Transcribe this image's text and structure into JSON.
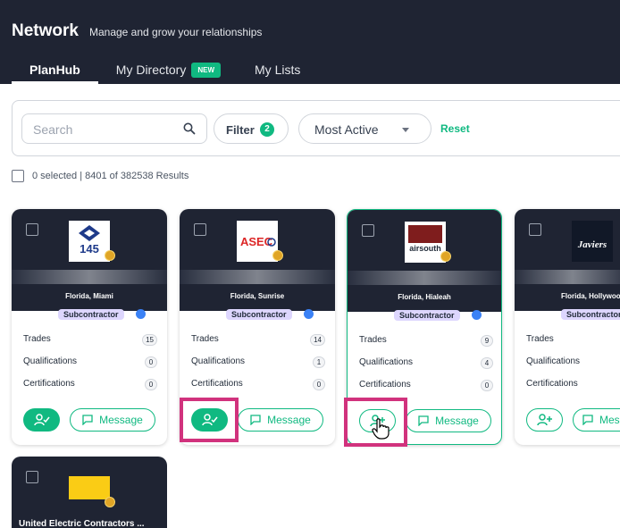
{
  "header": {
    "title": "Network",
    "subtitle": "Manage and grow your relationships",
    "tabs": [
      {
        "label": "PlanHub",
        "active": true
      },
      {
        "label": "My Directory",
        "badge": "NEW"
      },
      {
        "label": "My Lists"
      }
    ]
  },
  "toolbar": {
    "search_placeholder": "Search",
    "filter_label": "Filter",
    "filter_count": "2",
    "sort_value": "Most Active",
    "reset_label": "Reset"
  },
  "results": {
    "text": "0 selected | 8401 of 382538 Results"
  },
  "row_labels": {
    "trades": "Trades",
    "qualifications": "Qualifications",
    "certifications": "Certifications"
  },
  "message_label": "Message",
  "cards": [
    {
      "logo_text": "145",
      "location": "Florida, Miami",
      "type": "Subcontractor",
      "trades": "15",
      "qualifications": "0",
      "certifications": "0",
      "connected": true
    },
    {
      "logo_text": "ASEC",
      "location": "Florida, Sunrise",
      "type": "Subcontractor",
      "trades": "14",
      "qualifications": "1",
      "certifications": "0",
      "connected": true
    },
    {
      "logo_text": "airsouth",
      "location": "Florida, Hialeah",
      "type": "Subcontractor",
      "trades": "9",
      "qualifications": "4",
      "certifications": "0",
      "connected": false
    },
    {
      "logo_text": "Javiers",
      "location": "Florida, Hollywoo",
      "type": "Subcontractor",
      "trades": "",
      "qualifications": "",
      "certifications": "",
      "connected": false
    }
  ],
  "bottom_card": {
    "name": "United Electric Contractors ..."
  },
  "colors": {
    "header_bg": "#1f2433",
    "accent": "#10b981",
    "highlight": "#d1327d"
  }
}
